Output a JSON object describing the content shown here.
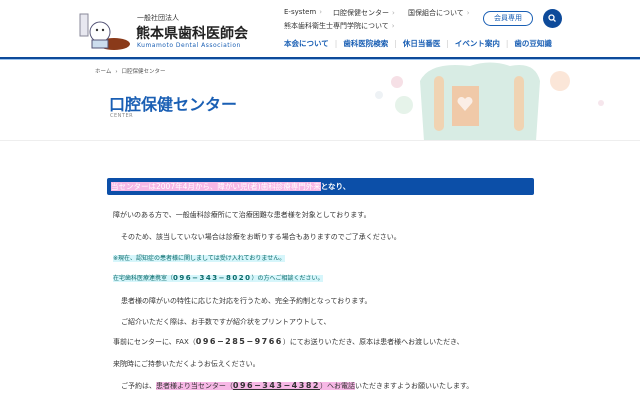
{
  "header": {
    "org_type": "一般社団法人",
    "org_name": "熊本県歯科医師会",
    "org_name_en": "Kumamoto Dental Association",
    "top_links": [
      "E-system",
      "口腔保健センター",
      "国保組合について",
      "熊本歯科衛生士専門学院について"
    ],
    "member_button": "会員専用",
    "nav": [
      "本会について",
      "歯科医院検索",
      "休日当番医",
      "イベント案内",
      "歯の豆知識"
    ]
  },
  "breadcrumb": [
    "ホーム",
    "口腔保健センター"
  ],
  "page": {
    "title": "口腔保健センター",
    "subtitle": "CENTER"
  },
  "content": {
    "heading_highlight": "当センターは2007年4月から、障がい児(者)歯科診療専門外来",
    "heading_rest": "となり、",
    "p1": "障がいのある方で、一般歯科診療所にて治療困難な患者様を対象としております。",
    "p2": "そのため、該当していない場合は診療をお断りする場合もありますのでご了承ください。",
    "note1": "※現在、認知症の患者様に関しましては受け入れておりません。",
    "note2_pre": "在宅歯科医療連携室（",
    "note2_tel": "096−343−8020",
    "note2_post": "）の方へご相談ください。",
    "p3": "患者様の障がいの特性に応じた対応を行うため、完全予約制となっております。",
    "p4": "ご紹介いただく際は、お手数ですが紹介状をプリントアウトして、",
    "p5_pre": "事前にセンターに、FAX（",
    "p5_tel": "096−285−9766",
    "p5_post": "）にてお送りいただき、原本は患者様へお渡しいただき、",
    "p6": "来院時にご持参いただくようお伝えください。",
    "p7_pre": "ご予約は、",
    "p7_hl_pre": "患者様より当センター（",
    "p7_tel": "096−343−4382",
    "p7_hl_post": "）へお電話",
    "p7_post": "いただきますようお願いいたします。"
  },
  "colors": {
    "brand": "#0d4a9a",
    "title": "#1a5fb4",
    "highlight": "#f7b8e6"
  }
}
